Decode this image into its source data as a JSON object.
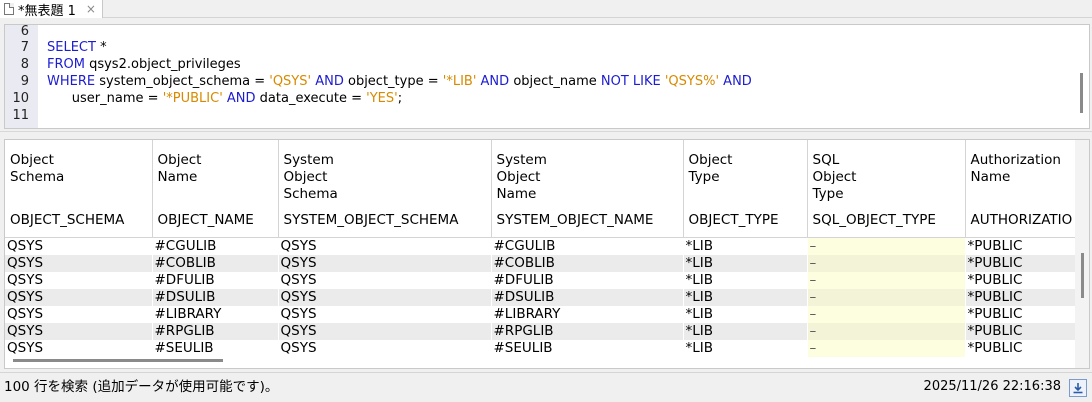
{
  "tab": {
    "title": "*無表題 1",
    "close": "×",
    "icon": "document-icon"
  },
  "editor": {
    "line_numbers": [
      "6",
      "7",
      "8",
      "9",
      "10",
      "11"
    ],
    "lines": [
      [],
      [
        {
          "t": "SELECT ",
          "k": "kw"
        },
        {
          "t": "*",
          "k": "pl"
        }
      ],
      [
        {
          "t": "FROM ",
          "k": "kw"
        },
        {
          "t": "qsys2.object_privileges",
          "k": "pl"
        }
      ],
      [
        {
          "t": "WHERE ",
          "k": "kw"
        },
        {
          "t": "system_object_schema = ",
          "k": "pl"
        },
        {
          "t": "'QSYS'",
          "k": "str"
        },
        {
          "t": " AND ",
          "k": "kw"
        },
        {
          "t": "object_type = ",
          "k": "pl"
        },
        {
          "t": "'*LIB'",
          "k": "str"
        },
        {
          "t": " AND ",
          "k": "kw"
        },
        {
          "t": "object_name ",
          "k": "pl"
        },
        {
          "t": "NOT LIKE ",
          "k": "kw"
        },
        {
          "t": "'QSYS%'",
          "k": "str"
        },
        {
          "t": " AND",
          "k": "kw"
        }
      ],
      [
        {
          "t": "      user_name = ",
          "k": "pl"
        },
        {
          "t": "'*PUBLIC'",
          "k": "str"
        },
        {
          "t": " AND ",
          "k": "kw"
        },
        {
          "t": "data_execute = ",
          "k": "pl"
        },
        {
          "t": "'YES'",
          "k": "str"
        },
        {
          "t": ";",
          "k": "pl"
        }
      ],
      []
    ]
  },
  "grid": {
    "columns": [
      {
        "label": [
          "Object",
          "Schema"
        ],
        "name": "OBJECT_SCHEMA"
      },
      {
        "label": [
          "Object",
          "Name"
        ],
        "name": "OBJECT_NAME"
      },
      {
        "label": [
          "System",
          "Object",
          "Schema"
        ],
        "name": "SYSTEM_OBJECT_SCHEMA"
      },
      {
        "label": [
          "System",
          "Object",
          "Name"
        ],
        "name": "SYSTEM_OBJECT_NAME"
      },
      {
        "label": [
          "Object",
          "Type"
        ],
        "name": "OBJECT_TYPE"
      },
      {
        "label": [
          "SQL",
          "Object",
          "Type"
        ],
        "name": "SQL_OBJECT_TYPE"
      },
      {
        "label": [
          "Authorization",
          "Name"
        ],
        "name": "AUTHORIZATIO"
      }
    ],
    "rows": [
      [
        "QSYS",
        "#CGULIB",
        "QSYS",
        "#CGULIB",
        "*LIB",
        "–",
        "*PUBLIC"
      ],
      [
        "QSYS",
        "#COBLIB",
        "QSYS",
        "#COBLIB",
        "*LIB",
        "–",
        "*PUBLIC"
      ],
      [
        "QSYS",
        "#DFULIB",
        "QSYS",
        "#DFULIB",
        "*LIB",
        "–",
        "*PUBLIC"
      ],
      [
        "QSYS",
        "#DSULIB",
        "QSYS",
        "#DSULIB",
        "*LIB",
        "–",
        "*PUBLIC"
      ],
      [
        "QSYS",
        "#LIBRARY",
        "QSYS",
        "#LIBRARY",
        "*LIB",
        "–",
        "*PUBLIC"
      ],
      [
        "QSYS",
        "#RPGLIB",
        "QSYS",
        "#RPGLIB",
        "*LIB",
        "–",
        "*PUBLIC"
      ],
      [
        "QSYS",
        "#SEULIB",
        "QSYS",
        "#SEULIB",
        "*LIB",
        "–",
        "*PUBLIC"
      ]
    ]
  },
  "status": {
    "message": "100 行を検索 (追加データが使用可能です)。",
    "timestamp": "2025/11/26 22:16:38",
    "download_icon": "download-icon"
  },
  "colors": {
    "keyword": "#1c1cd2",
    "string": "#d78a00",
    "gutter": "#eaeaf2",
    "alt_row": "#ebebeb",
    "sql_type_bg": "#fdfde0"
  }
}
